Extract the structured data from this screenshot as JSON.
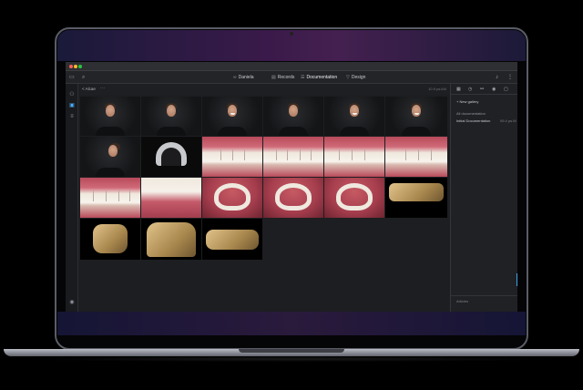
{
  "toolbar": {
    "patient_tab": "Daniela",
    "records_tab": "Records",
    "documentation_tab": "Documentation",
    "design_tab": "Design"
  },
  "breadcrumb": {
    "label": "< Alcae",
    "more": "···",
    "date": "10.9 ps.M4"
  },
  "right_panel": {
    "new_gallery": "New gallery",
    "all_documentation": "All documentation",
    "initial_documentation": "Initial Documentation",
    "initial_documentation_date": "09.4 ps.M",
    "footer": "Articles"
  },
  "icons": {
    "toolbar_left": [
      "folder-icon",
      "search-icon"
    ],
    "toolbar_right": [
      "bell-icon",
      "more-icon"
    ],
    "left_bar": [
      "users-icon",
      "gallery-icon",
      "list-icon",
      "profile-icon"
    ],
    "right_panel": [
      "calendar-icon",
      "clock-icon",
      "link-icon",
      "view-icon",
      "chat-icon"
    ]
  },
  "colors": {
    "accent": "#48b0ff",
    "app_bg": "#1d1e21",
    "window_close": "#ff5f57",
    "window_min": "#febc2e",
    "window_max": "#28c840"
  },
  "gallery": {
    "photos": [
      "portrait-right",
      "portrait-three-quarter-right",
      "portrait-smile-front",
      "portrait-neutral-front",
      "portrait-three-quarter-left",
      "portrait-smile-left",
      "portrait-profile",
      "panoramic-xray",
      "teeth-close-up-smile",
      "teeth-retracted-front",
      "teeth-retracted-lateral",
      "teeth-edge-close-up",
      "teeth-front-open",
      "teeth-lower-lip",
      "occlusal-upper",
      "occlusal-upper-retracted",
      "occlusal-lower",
      "model-scan-lateral",
      "model-scan-upper",
      "model-scan-front",
      "model-scan-lower"
    ]
  }
}
